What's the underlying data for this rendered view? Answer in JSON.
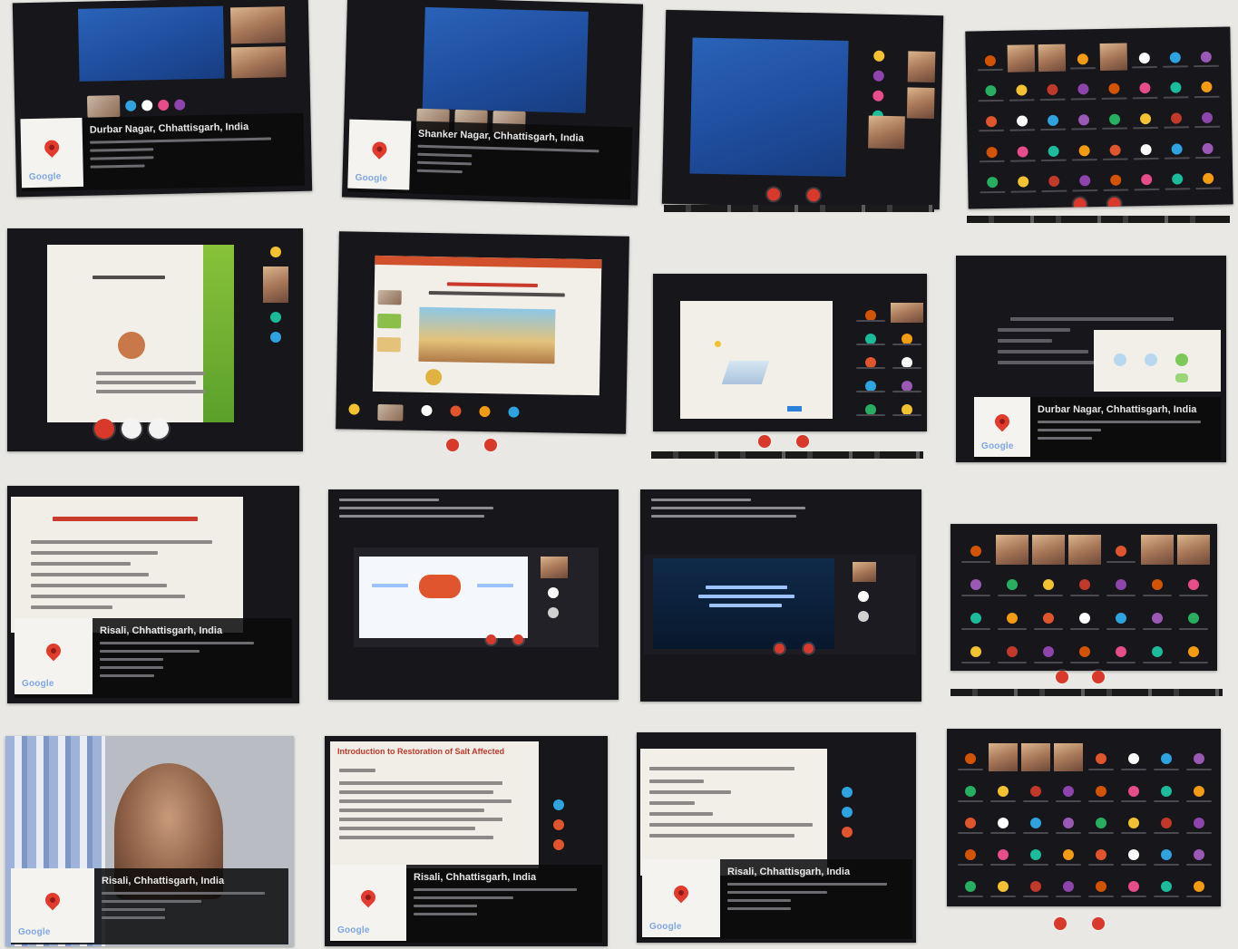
{
  "image": {
    "layout": "4x4 collage of online meeting screenshots"
  },
  "tiles": [
    {
      "row": 1,
      "col": 1,
      "kind": "blue-slide-with-geotag",
      "place": "Durbar Nagar, Chhattisgarh, India"
    },
    {
      "row": 1,
      "col": 2,
      "kind": "blue-slide-with-geotag",
      "place": "Shanker Nagar, Chhattisgarh, India"
    },
    {
      "row": 1,
      "col": 3,
      "kind": "blue-slide-with-participants"
    },
    {
      "row": 1,
      "col": 4,
      "kind": "participant-grid"
    },
    {
      "row": 2,
      "col": 1,
      "kind": "white-slide-presentation"
    },
    {
      "row": 2,
      "col": 2,
      "kind": "building-slide-presentation"
    },
    {
      "row": 2,
      "col": 3,
      "kind": "white-slide-with-participants"
    },
    {
      "row": 2,
      "col": 4,
      "kind": "dark-slide-with-geotag",
      "place": "Durbar Nagar, Chhattisgarh, India"
    },
    {
      "row": 3,
      "col": 1,
      "kind": "text-slide-with-geotag",
      "place": "Risali, Chhattisgarh, India"
    },
    {
      "row": 3,
      "col": 2,
      "kind": "photo-of-screen"
    },
    {
      "row": 3,
      "col": 3,
      "kind": "photo-of-screen-dark"
    },
    {
      "row": 3,
      "col": 4,
      "kind": "participant-grid"
    },
    {
      "row": 4,
      "col": 1,
      "kind": "speaker-video-with-geotag",
      "place": "Risali, Chhattisgarh, India"
    },
    {
      "row": 4,
      "col": 2,
      "kind": "text-slide-with-geotag",
      "place": "Risali, Chhattisgarh, India",
      "slide_title": "Introduction to Restoration of Salt Affected"
    },
    {
      "row": 4,
      "col": 3,
      "kind": "text-slide-with-geotag",
      "place": "Risali, Chhattisgarh, India"
    },
    {
      "row": 4,
      "col": 4,
      "kind": "participant-grid"
    }
  ],
  "geo_tags": {
    "t1": "Durbar Nagar, Chhattisgarh, India",
    "t2": "Shanker Nagar, Chhattisgarh, India",
    "t8": "Durbar Nagar, Chhattisgarh, India",
    "t9": "Risali, Chhattisgarh, India",
    "t13": "Risali, Chhattisgarh, India",
    "t14": "Risali, Chhattisgarh, India",
    "t15": "Risali, Chhattisgarh, India"
  },
  "map_brand": "Google",
  "slide_title_t14": "Introduction to Restoration of Salt Affected",
  "colors": {
    "background": "#e9e8e4",
    "tile": "#17161a",
    "call_end_red": "#d8392b",
    "map_pin": "#e23b2e"
  },
  "avatar_colors": [
    "#f2c230",
    "#e0552d",
    "#8e44ad",
    "#2ea3e0",
    "#e74c8b",
    "#27ae60",
    "#f39c12",
    "#c0392b",
    "#ffffff",
    "#d35400",
    "#9b59b6",
    "#1abc9c"
  ]
}
